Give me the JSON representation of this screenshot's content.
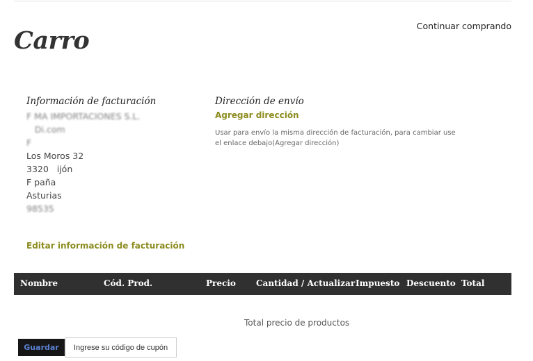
{
  "header": {
    "continue_label": "Continuar comprando",
    "title": "Carro"
  },
  "billing": {
    "heading": "Información de facturación",
    "lines": [
      "F MA IMPORTACIONES S.L.",
      "   Di.com",
      "F             ",
      "Los Moros 32",
      "3320   ijón",
      "F paña",
      "Asturias",
      "98535    ",
      "         ",
      "        "
    ],
    "edit_label": "Editar información de facturación"
  },
  "shipping": {
    "heading": "Dirección de envío",
    "add_label": "Agregar dirección",
    "note": "Usar para envío la misma dirección de facturación, para cambiar use el enlace debajo(Agregar dirección)"
  },
  "table": {
    "columns": [
      "Nombre",
      "Cód. Prod.",
      "Precio",
      "Cantidad / Actualizar",
      "Impuesto",
      "Descuento",
      "Total"
    ]
  },
  "totals": {
    "label": "Total precio de productos"
  },
  "actions": {
    "save_label": "Guardar",
    "coupon_placeholder": "Ingrese su código de cupón"
  }
}
